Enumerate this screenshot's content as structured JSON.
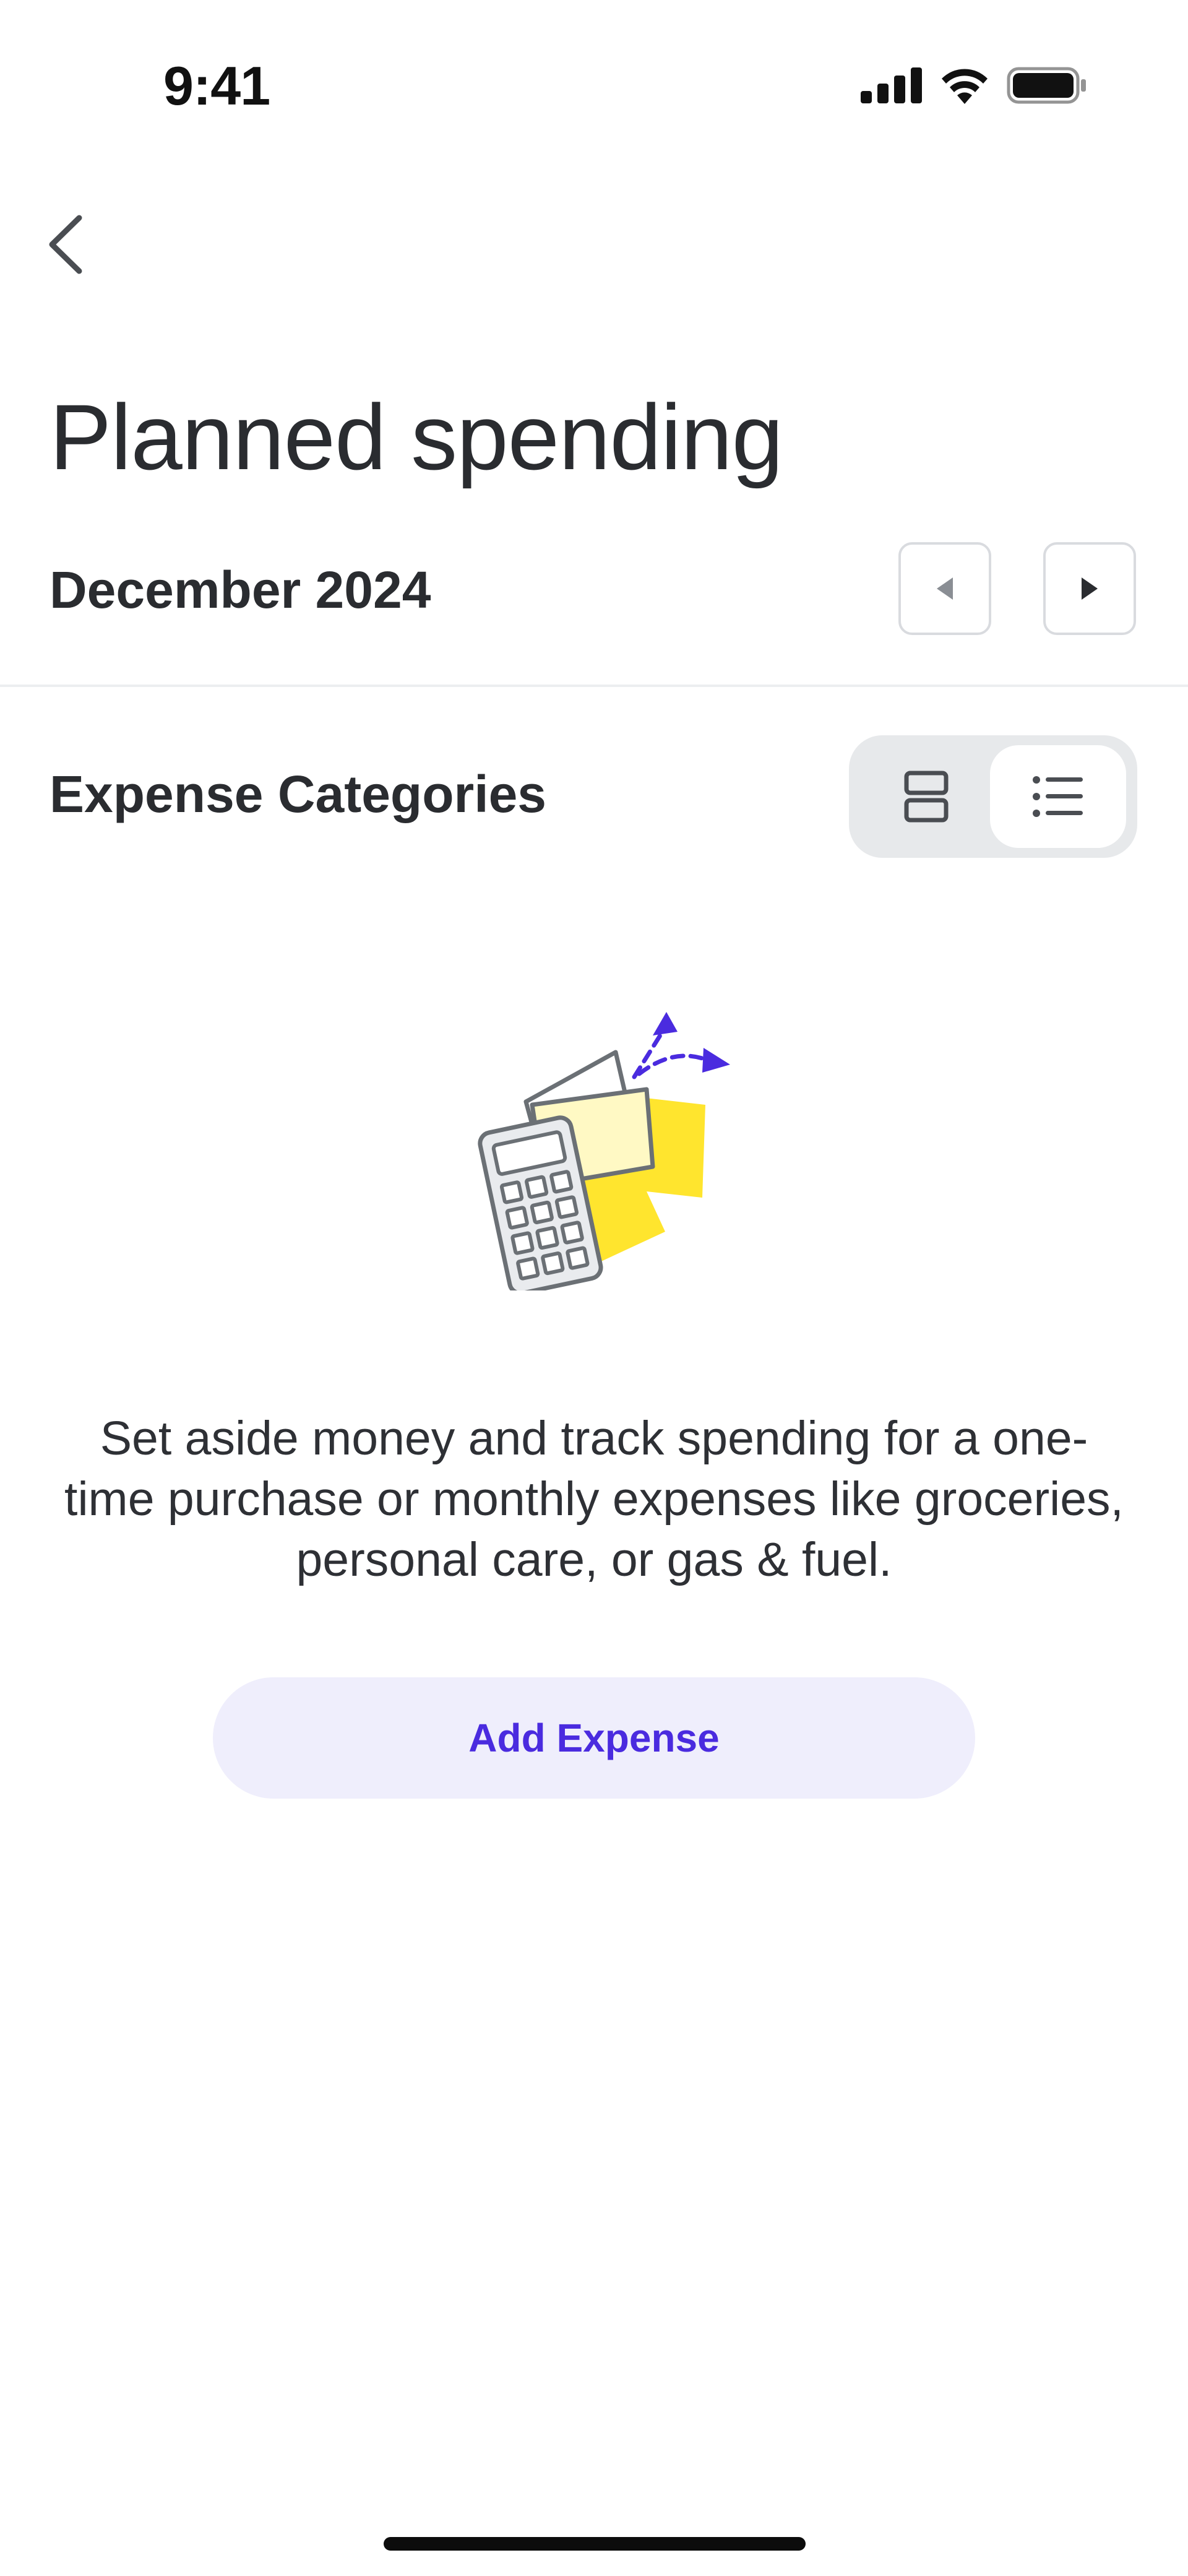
{
  "status_bar": {
    "time": "9:41",
    "icons": [
      "signal-icon",
      "wifi-icon",
      "battery-icon"
    ]
  },
  "nav": {
    "back_icon": "chevron-left-icon"
  },
  "page": {
    "title": "Planned spending",
    "month": "December 2024",
    "prev_icon": "caret-left-icon",
    "next_icon": "caret-right-icon"
  },
  "section": {
    "title": "Expense Categories",
    "view_toggle": {
      "options": [
        "grid-view-icon",
        "list-view-icon"
      ],
      "selected": "list-view-icon"
    }
  },
  "empty_state": {
    "illustration": "wallet-calculator-illustration",
    "text": "Set aside money and track spending for a one-time purchase or monthly expenses like groceries, personal care, or gas & fuel.",
    "button_label": "Add Expense"
  },
  "colors": {
    "accent": "#4a2bdf",
    "button_bg": "#efeefc",
    "illustration_yellow": "#ffe52e",
    "icon_gray": "#6b7075"
  }
}
